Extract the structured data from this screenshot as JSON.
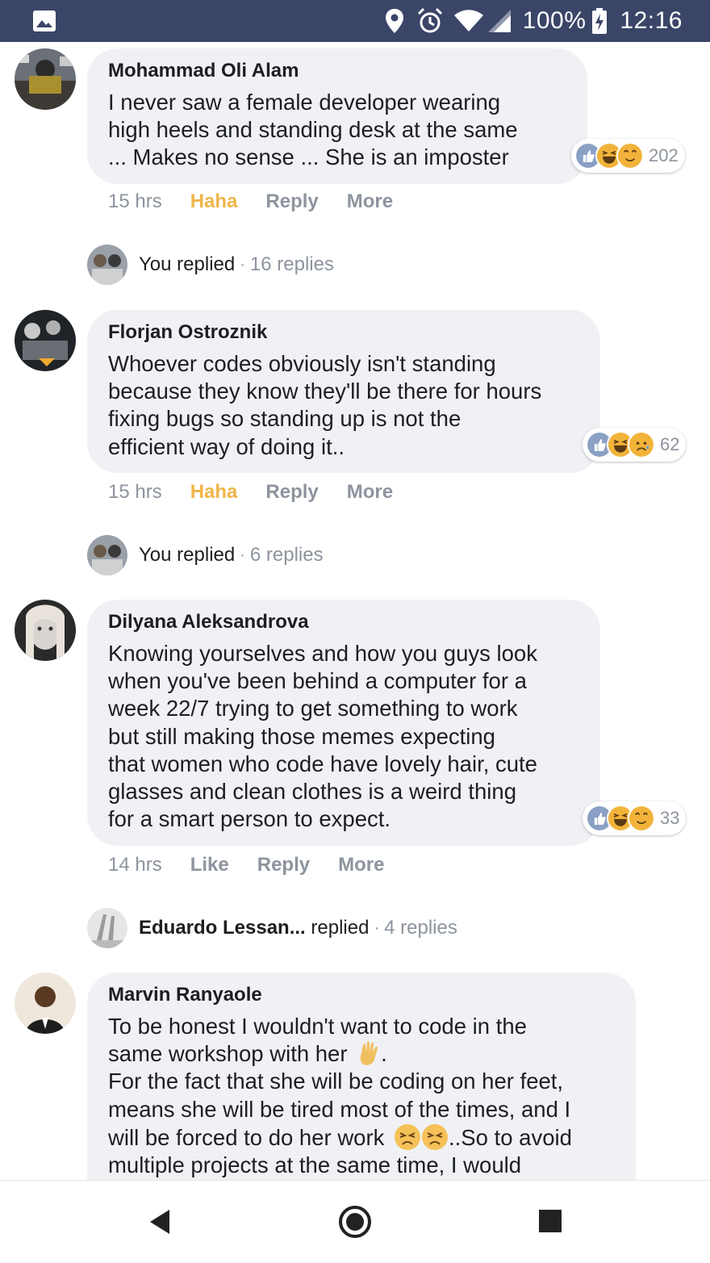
{
  "status_bar": {
    "battery": "100%",
    "time": "12:16"
  },
  "comments": [
    {
      "author": "Mohammad Oli Alam",
      "text": "I never saw a female developer wearing\nhigh heels and standing desk at the same\n... Makes no sense ... She is an imposter",
      "reaction_count": "202",
      "time": "15 hrs",
      "react_label": "Haha",
      "reply_label": "Reply",
      "more_label": "More",
      "replies": {
        "who": "You replied",
        "count": "16 replies"
      }
    },
    {
      "author": "Florjan Ostroznik",
      "text": "Whoever codes obviously isn't standing\nbecause they know they'll be there for hours\nfixing bugs so standing up is not the\nefficient way of doing it..",
      "reaction_count": "62",
      "time": "15 hrs",
      "react_label": "Haha",
      "reply_label": "Reply",
      "more_label": "More",
      "replies": {
        "who": "You replied",
        "count": "6 replies"
      }
    },
    {
      "author": "Dilyana Aleksandrova",
      "text": "Knowing yourselves and how you guys look\nwhen you've been behind a computer for a\nweek 22/7 trying to get something to work\nbut still making those memes expecting\nthat women who code have lovely hair, cute\nglasses and clean clothes is a weird thing\nfor a smart person to expect.",
      "reaction_count": "33",
      "time": "14 hrs",
      "react_label": "Like",
      "reply_label": "Reply",
      "more_label": "More",
      "replies": {
        "who_name": "Eduardo Lessan...",
        "who_suffix": "replied",
        "count": "4 replies"
      }
    },
    {
      "author": "Marvin Ranyaole",
      "text_line1": "To be honest I wouldn't want to code in the",
      "text_line2a": "same workshop with her",
      "text_line2b": ".",
      "text_line3": "For the fact that she will be coding on her feet,",
      "text_line4": "means she will be tired most of the times, and I",
      "text_line5a": "will be forced to do her work",
      "text_line5b": "..So to avoid",
      "text_line6": "multiple projects at the same time, I would"
    }
  ],
  "colors": {
    "status_bar": "#3b4568",
    "bubble": "#f0f1f4",
    "haha": "#f0b54a",
    "meta_gray": "#8d949e"
  },
  "icons": {
    "status": [
      "gallery-icon",
      "location-icon",
      "alarm-icon",
      "wifi-icon",
      "signal-icon",
      "battery-charging-icon"
    ],
    "reactions": [
      "like-icon",
      "haha-icon",
      "love-icon",
      "sad-icon"
    ],
    "nav": [
      "back-icon",
      "home-icon",
      "recents-icon"
    ]
  }
}
